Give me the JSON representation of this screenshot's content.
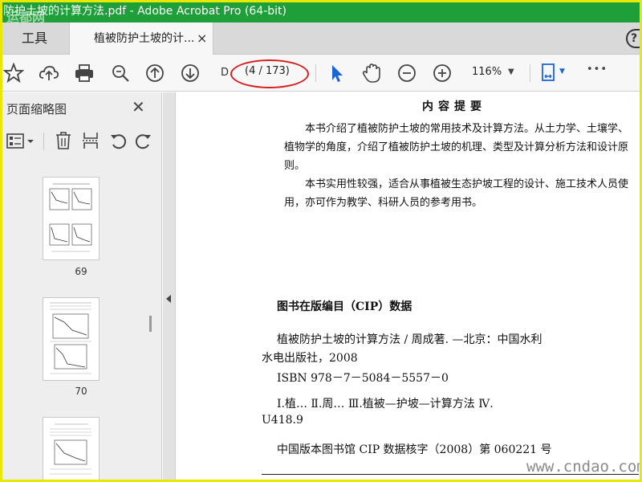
{
  "window": {
    "title": "防护土坡的计算方法.pdf - Adobe Acrobat Pro (64-bit)"
  },
  "tabs": {
    "tools_label": "工具",
    "document_label": "植被防护土坡的计...",
    "close_glyph": "×",
    "help_glyph": "?"
  },
  "toolbar": {
    "page_input_value": "D",
    "page_count": "(4 / 173)",
    "zoom_value": "116%",
    "zoom_caret": "▼",
    "more_glyph": "•••"
  },
  "sidepanel": {
    "title": "页面缩略图",
    "close_glyph": "✕",
    "thumbnails": [
      {
        "page": "69"
      },
      {
        "page": "70"
      },
      {
        "page": ""
      }
    ]
  },
  "document": {
    "summary_title": "内容提要",
    "summary_para1": "本书介绍了植被防护土坡的常用技术及计算方法。从土力学、土壤学、植物学的角度，介绍了植被防护土坡的机理、类型及计算分析方法和设计原则。",
    "summary_para2": "本书实用性较强，适合从事植被生态护坡工程的设计、施工技术人员使用，亦可作为教学、科研人员的参考用书。",
    "cip_title": "图书在版编目（CIP）数据",
    "cip_line1": "植被防护土坡的计算方法 / 周成著. —北京：中国水利",
    "cip_line2": "水电出版社，2008",
    "cip_line3": "ISBN 978－7－5084－5557－0",
    "cip_line4": "Ⅰ.植…  Ⅱ.周…  Ⅲ.植被—护坡—计算方法  Ⅳ.",
    "cip_line5": "U418.9",
    "cip_line6": "中国版本图书馆 CIP 数据核字（2008）第 060221 号"
  },
  "watermarks": {
    "top_left": "运都网",
    "bottom_right": "www.cndao.com"
  },
  "colors": {
    "titlebar": "#1f9f3a",
    "highlight_ellipse": "#d42020",
    "accent_blue": "#1a66d6"
  }
}
